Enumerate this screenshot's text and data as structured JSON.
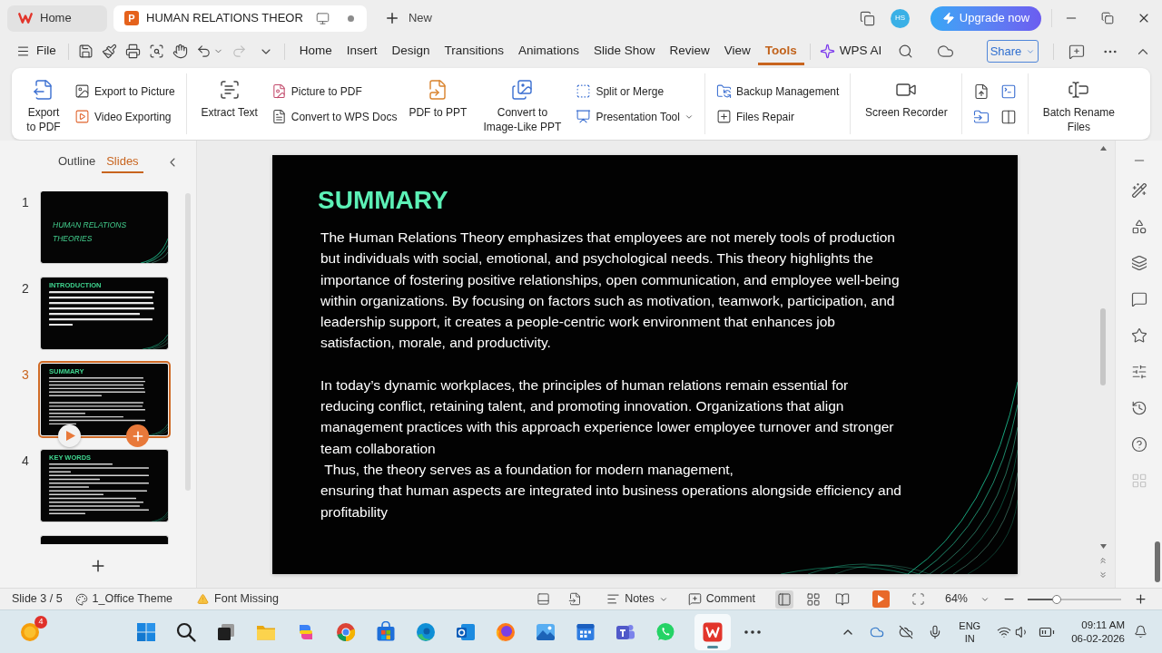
{
  "tab_bar": {
    "tabs": [
      {
        "kind": "home",
        "label": "Home",
        "selected": false,
        "modified": false
      },
      {
        "kind": "document",
        "icon_letter": "P",
        "label": "HUMAN RELATIONS THEOR",
        "selected": true,
        "modified": true
      }
    ],
    "new_tab": "New",
    "avatar": "HS",
    "upgrade_button": "Upgrade now"
  },
  "menu_bar": {
    "file": "File",
    "tabs": [
      {
        "label": "Home",
        "selected": false
      },
      {
        "label": "Insert",
        "selected": false
      },
      {
        "label": "Design",
        "selected": false
      },
      {
        "label": "Transitions",
        "selected": false
      },
      {
        "label": "Animations",
        "selected": false
      },
      {
        "label": "Slide Show",
        "selected": false
      },
      {
        "label": "Review",
        "selected": false
      },
      {
        "label": "View",
        "selected": false
      },
      {
        "label": "Tools",
        "selected": true
      }
    ],
    "ai_button": "WPS AI",
    "share_button": "Share"
  },
  "ribbon": {
    "groups": [
      {
        "kind": "buttons",
        "items": [
          {
            "kind": "large",
            "label": "Export to PDF"
          },
          {
            "kind": "stack",
            "items": [
              {
                "label": "Export to Picture",
                "dropdown": false
              },
              {
                "label": "Video Exporting",
                "dropdown": false
              }
            ]
          }
        ]
      },
      {
        "kind": "buttons",
        "items": [
          {
            "kind": "large",
            "label": "Extract Text"
          },
          {
            "kind": "stack",
            "items": [
              {
                "label": "Picture to PDF",
                "dropdown": false
              },
              {
                "label": "Convert to WPS Docs",
                "dropdown": false
              }
            ]
          },
          {
            "kind": "large",
            "label": "PDF to PPT"
          },
          {
            "kind": "large",
            "label": "Convert to Image-Like PPT"
          },
          {
            "kind": "stack",
            "items": [
              {
                "label": "Split or Merge",
                "dropdown": false
              },
              {
                "label": "Presentation Tool",
                "dropdown": true
              }
            ]
          }
        ]
      },
      {
        "kind": "buttons",
        "items": [
          {
            "kind": "stack",
            "items": [
              {
                "label": "Backup Management",
                "dropdown": false
              },
              {
                "label": "Files Repair",
                "dropdown": false
              }
            ]
          }
        ]
      },
      {
        "kind": "buttons",
        "items": [
          {
            "kind": "large",
            "label": "Screen Recorder"
          }
        ]
      },
      {
        "kind": "icons"
      },
      {
        "kind": "buttons",
        "items": [
          {
            "kind": "large",
            "label": "Batch Rename Files"
          }
        ]
      }
    ]
  },
  "slides_panel": {
    "tabs": [
      {
        "label": "Outline",
        "selected": false
      },
      {
        "label": "Slides",
        "selected": true
      }
    ],
    "slides": [
      {
        "kind": "title",
        "number": "1",
        "selected": false,
        "title": "HUMAN RELATIONS THEORIES"
      },
      {
        "kind": "content",
        "number": "2",
        "selected": false,
        "heading": "INTRODUCTION"
      },
      {
        "kind": "content",
        "number": "3",
        "selected": true,
        "heading": "SUMMARY"
      },
      {
        "kind": "content",
        "number": "4",
        "selected": false,
        "heading": "KEY WORDS"
      },
      {
        "kind": "blank",
        "selected": false
      }
    ]
  },
  "editor": {
    "slide": {
      "title": "SUMMARY",
      "paragraphs": [
        "The Human Relations Theory emphasizes that employees are not merely tools of production but individuals with social, emotional, and psychological needs. This theory highlights the importance of fostering positive relationships, open communication, and employee well-being within organizations. By focusing on factors such as motivation, teamwork, participation, and leadership support, it creates a people-centric work environment that enhances job satisfaction, morale, and productivity.",
        "In today’s dynamic workplaces, the principles of human relations remain essential for reducing conflict, retaining talent, and promoting innovation. Organizations that align management practices with this approach experience lower employee turnover and stronger team collaboration\n Thus, the theory serves as a foundation for modern management,\nensuring that human aspects are integrated into business operations alongside efficiency and profitability"
      ]
    }
  },
  "status_bar": {
    "slide_indicator": "Slide 3 / 5",
    "theme": "1_Office Theme",
    "font_warning": "Font Missing",
    "notes_button": "Notes",
    "comment_button": "Comment",
    "views": [
      {
        "kind": "normal",
        "selected": true
      },
      {
        "kind": "sorter",
        "selected": false
      },
      {
        "kind": "reading",
        "selected": false
      },
      {
        "kind": "slideshow",
        "selected": false
      }
    ],
    "zoom": "64%",
    "zoom_slider": {
      "level": 0.31
    }
  },
  "taskbar": {
    "apps": [
      {
        "kind": "weather",
        "badge": "4",
        "selected": false
      },
      {
        "kind": "start",
        "selected": false
      },
      {
        "kind": "search",
        "selected": false
      },
      {
        "kind": "taskview",
        "selected": false
      },
      {
        "kind": "explorer",
        "selected": false
      },
      {
        "kind": "copilot",
        "selected": false
      },
      {
        "kind": "chrome",
        "selected": false
      },
      {
        "kind": "store",
        "selected": false
      },
      {
        "kind": "edge",
        "selected": false
      },
      {
        "kind": "outlook",
        "selected": false
      },
      {
        "kind": "firefox",
        "selected": false
      },
      {
        "kind": "photos",
        "selected": false
      },
      {
        "kind": "calendar",
        "selected": false
      },
      {
        "kind": "teams",
        "selected": false
      },
      {
        "kind": "whatsapp",
        "selected": false
      },
      {
        "kind": "wps",
        "selected": true
      },
      {
        "kind": "more",
        "selected": false
      }
    ],
    "language": "ENG",
    "region": "IN",
    "time": "09:11 AM",
    "date": "06-02-2026"
  }
}
